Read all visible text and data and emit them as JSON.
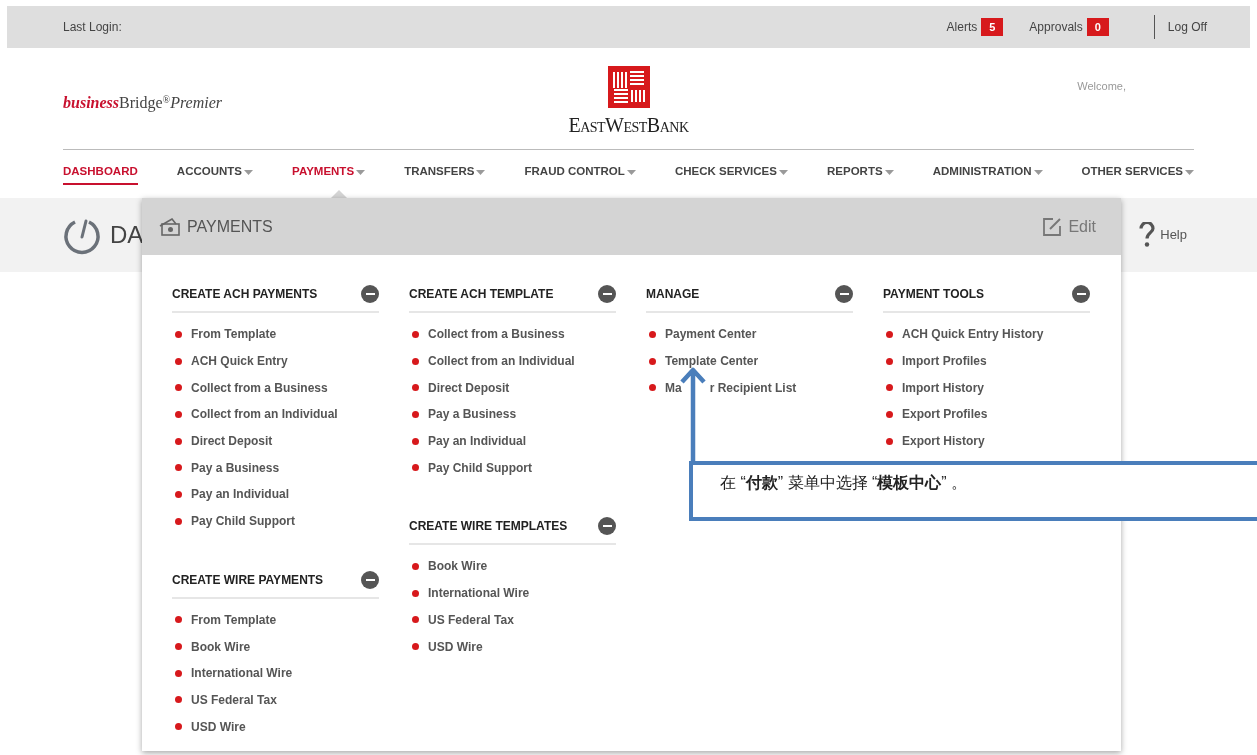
{
  "top_bar": {
    "last_login": "Last Login:",
    "alerts": {
      "label": "Alerts",
      "count": "5"
    },
    "approvals": {
      "label": "Approvals",
      "count": "0"
    },
    "log_off": "Log Off"
  },
  "brand": {
    "emphasis": "business",
    "name": "Bridge",
    "mark": "®",
    "tier": "Premier"
  },
  "bank_logo": "EastWestBank",
  "welcome": "Welcome,",
  "nav": [
    {
      "label": "DASHBOARD",
      "selected": true,
      "expanded": false,
      "has_menu": false
    },
    {
      "label": "ACCOUNTS",
      "selected": false,
      "expanded": false,
      "has_menu": true
    },
    {
      "label": "PAYMENTS",
      "selected": false,
      "expanded": true,
      "has_menu": true
    },
    {
      "label": "TRANSFERS",
      "selected": false,
      "expanded": false,
      "has_menu": true
    },
    {
      "label": "FRAUD CONTROL",
      "selected": false,
      "expanded": false,
      "has_menu": true
    },
    {
      "label": "CHECK SERVICES",
      "selected": false,
      "expanded": false,
      "has_menu": true
    },
    {
      "label": "REPORTS",
      "selected": false,
      "expanded": false,
      "has_menu": true
    },
    {
      "label": "ADMINISTRATION",
      "selected": false,
      "expanded": false,
      "has_menu": true
    },
    {
      "label": "OTHER SERVICES",
      "selected": false,
      "expanded": false,
      "has_menu": true
    }
  ],
  "page_title": "DA",
  "help": "Help",
  "menu": {
    "title": "PAYMENTS",
    "edit": "Edit",
    "columns": [
      {
        "sections": [
          {
            "title": "CREATE ACH PAYMENTS",
            "expanded": true,
            "items": [
              "From Template",
              "ACH Quick Entry",
              "Collect from a Business",
              "Collect from an Individual",
              "Direct Deposit",
              "Pay a Business",
              "Pay an Individual",
              "Pay Child Support"
            ]
          },
          {
            "title": "CREATE WIRE PAYMENTS",
            "expanded": true,
            "items": [
              "From Template",
              "Book Wire",
              "International Wire",
              "US Federal Tax",
              "USD Wire"
            ]
          }
        ]
      },
      {
        "sections": [
          {
            "title": "CREATE ACH TEMPLATE",
            "expanded": true,
            "items": [
              "Collect from a Business",
              "Collect from an Individual",
              "Direct Deposit",
              "Pay a Business",
              "Pay an Individual",
              "Pay Child Support"
            ]
          },
          {
            "title": "CREATE WIRE TEMPLATES",
            "expanded": true,
            "items": [
              "Book Wire",
              "International Wire",
              "US Federal Tax",
              "USD Wire"
            ]
          }
        ]
      },
      {
        "sections": [
          {
            "title": "MANAGE",
            "expanded": true,
            "items": [
              "Payment Center",
              "Template Center",
              [
                "Ma",
                "r Recipient List"
              ]
            ]
          }
        ]
      },
      {
        "sections": [
          {
            "title": "PAYMENT TOOLS",
            "expanded": true,
            "items": [
              "ACH Quick Entry History",
              "Import Profiles",
              "Import History",
              "Export Profiles",
              "Export History"
            ]
          }
        ]
      }
    ]
  },
  "callout": {
    "text": "在 “**付款**” 菜单中选择 “**模板中心**” 。"
  }
}
